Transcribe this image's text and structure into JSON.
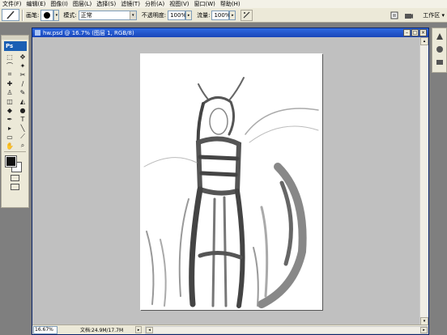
{
  "menu": [
    "文件(F)",
    "编辑(E)",
    "图像(I)",
    "图层(L)",
    "选择(S)",
    "滤镜(T)",
    "分析(A)",
    "视图(V)",
    "窗口(W)",
    "帮助(H)"
  ],
  "options": {
    "brush_label": "画笔:",
    "brush_size": "9",
    "mode_label": "模式:",
    "mode_value": "正常",
    "opacity_label": "不透明度:",
    "opacity_value": "100%",
    "flow_label": "流量:",
    "flow_value": "100%",
    "workspace_label": "工作区 ▾"
  },
  "document": {
    "title": "hw.psd @ 16.7% (图层 1, RGB/8)",
    "zoom": "16.67%",
    "doc_info": "文档:24.9M/17.7M"
  },
  "toolbox": {
    "logo": "Ps",
    "tools": [
      "marquee-icon",
      "move-icon",
      "lasso-icon",
      "magic-wand-icon",
      "crop-icon",
      "slice-icon",
      "healing-icon",
      "brush-icon",
      "stamp-icon",
      "history-brush-icon",
      "eraser-icon",
      "bucket-icon",
      "blur-icon",
      "dodge-icon",
      "pen-icon",
      "type-icon",
      "path-select-icon",
      "line-icon",
      "notes-icon",
      "eyedropper-icon",
      "hand-icon",
      "zoom-icon"
    ],
    "glyphs": [
      "⬚",
      "✥",
      "⌒",
      "✦",
      "⌗",
      "✂",
      "✚",
      "∕",
      "♙",
      "✎",
      "◫",
      "◭",
      "◆",
      "●",
      "✒",
      "T",
      "▸",
      "╲",
      "▭",
      "⟋",
      "✋",
      "⌕"
    ],
    "foreground_color": "#111111",
    "background_color": "#ffffff"
  },
  "colors": {
    "accent_title": "#1945b8",
    "canvas_bg": "#c0c0c0",
    "app_bg": "#7f7f7f"
  }
}
